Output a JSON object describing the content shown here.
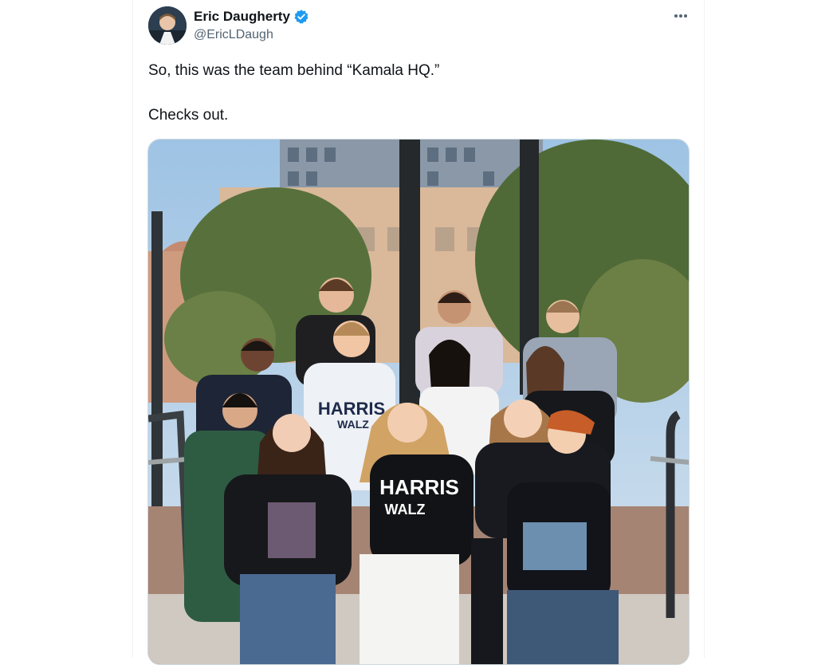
{
  "author": {
    "display_name": "Eric Daugherty",
    "handle": "@EricLDaugh",
    "verified": true,
    "avatar_icon": "profile-photo"
  },
  "tweet": {
    "lines": [
      "So, this was the team behind “Kamala HQ.”",
      "Checks out."
    ]
  },
  "media": {
    "shirt_text_top": "HARRIS",
    "shirt_text_bottom": "WALZ"
  },
  "icons": {
    "verified": "verified-badge-icon",
    "more": "more-options-icon"
  },
  "colors": {
    "verified_blue": "#1d9bf0",
    "text_primary": "#0f1419",
    "text_secondary": "#536471",
    "border": "#cfd9de"
  }
}
